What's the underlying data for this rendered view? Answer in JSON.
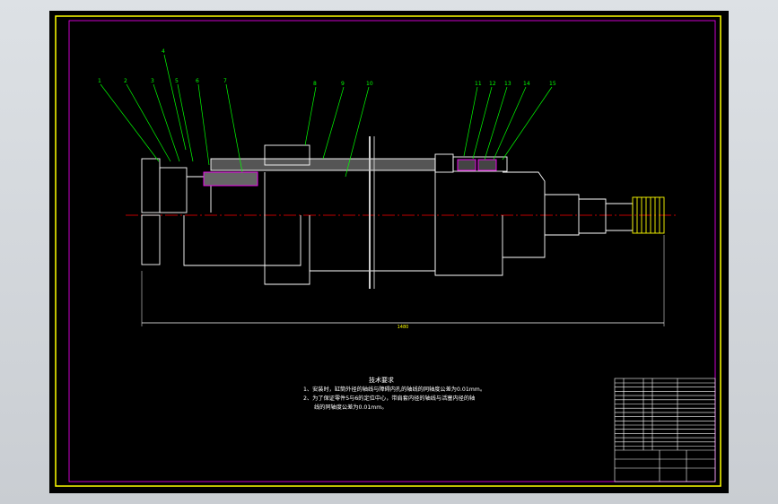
{
  "drawing": {
    "background_color": "#000000",
    "frame_color": "#ffff00",
    "line_color": "#ffffff",
    "leader_color": "#00ff00",
    "centerline_color": "#ff0000",
    "accent_color": "#ff00ff",
    "part_labels": [
      "1",
      "2",
      "3",
      "4",
      "5",
      "6",
      "7",
      "8",
      "9",
      "10",
      "11",
      "12",
      "13",
      "14",
      "15"
    ],
    "overall_dimension": "1480",
    "technical_requirements": {
      "title": "技术要求",
      "line1": "1、安装时，缸筒外径的轴线与障碍内孔的轴线的同轴度公差为0.01mm。",
      "line2": "2、为了保证零件5与6的定位中心，带肩套内径的轴线与活塞内径的轴",
      "line3": "线的同轴度公差为0.01mm。"
    }
  }
}
